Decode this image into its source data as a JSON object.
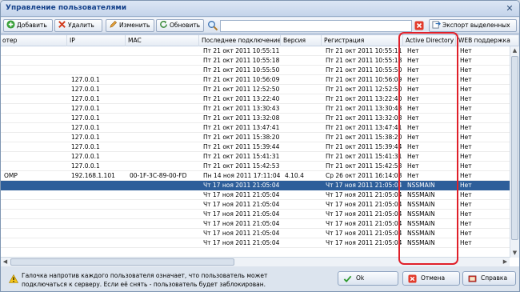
{
  "window": {
    "title": "Управление пользователями",
    "close_glyph": "✕"
  },
  "toolbar": {
    "add": "Добавить",
    "delete": "Удалить",
    "edit": "Изменить",
    "refresh": "Обновить",
    "search_value": "",
    "export": "Экспорт выделенных"
  },
  "columns": {
    "computer": "отер",
    "ip": "IP",
    "mac": "MAC",
    "last_conn": "Последнее подключение",
    "version": "Версия",
    "registration": "Регистрация",
    "ad": "Active Directory",
    "web": "WEB поддержка"
  },
  "rows": [
    {
      "computer": "",
      "ip": "",
      "mac": "",
      "last_conn": "Пт 21 окт 2011 10:55:11",
      "version": "",
      "registration": "Пт 21 окт 2011 10:55:11",
      "ad": "Нет",
      "web": "Нет",
      "selected": false
    },
    {
      "computer": "",
      "ip": "",
      "mac": "",
      "last_conn": "Пт 21 окт 2011 10:55:18",
      "version": "",
      "registration": "Пт 21 окт 2011 10:55:18",
      "ad": "Нет",
      "web": "Нет",
      "selected": false
    },
    {
      "computer": "",
      "ip": "",
      "mac": "",
      "last_conn": "Пт 21 окт 2011 10:55:50",
      "version": "",
      "registration": "Пт 21 окт 2011 10:55:50",
      "ad": "Нет",
      "web": "Нет",
      "selected": false
    },
    {
      "computer": "",
      "ip": "127.0.0.1",
      "mac": "",
      "last_conn": "Пт 21 окт 2011 10:56:09",
      "version": "",
      "registration": "Пт 21 окт 2011 10:56:09",
      "ad": "Нет",
      "web": "Нет",
      "selected": false
    },
    {
      "computer": "",
      "ip": "127.0.0.1",
      "mac": "",
      "last_conn": "Пт 21 окт 2011 12:52:50",
      "version": "",
      "registration": "Пт 21 окт 2011 12:52:50",
      "ad": "Нет",
      "web": "Нет",
      "selected": false
    },
    {
      "computer": "",
      "ip": "127.0.0.1",
      "mac": "",
      "last_conn": "Пт 21 окт 2011 13:22:40",
      "version": "",
      "registration": "Пт 21 окт 2011 13:22:40",
      "ad": "Нет",
      "web": "Нет",
      "selected": false
    },
    {
      "computer": "",
      "ip": "127.0.0.1",
      "mac": "",
      "last_conn": "Пт 21 окт 2011 13:30:43",
      "version": "",
      "registration": "Пт 21 окт 2011 13:30:43",
      "ad": "Нет",
      "web": "Нет",
      "selected": false
    },
    {
      "computer": "",
      "ip": "127.0.0.1",
      "mac": "",
      "last_conn": "Пт 21 окт 2011 13:32:08",
      "version": "",
      "registration": "Пт 21 окт 2011 13:32:08",
      "ad": "Нет",
      "web": "Нет",
      "selected": false
    },
    {
      "computer": "",
      "ip": "127.0.0.1",
      "mac": "",
      "last_conn": "Пт 21 окт 2011 13:47:41",
      "version": "",
      "registration": "Пт 21 окт 2011 13:47:41",
      "ad": "Нет",
      "web": "Нет",
      "selected": false
    },
    {
      "computer": "",
      "ip": "127.0.0.1",
      "mac": "",
      "last_conn": "Пт 21 окт 2011 15:38:20",
      "version": "",
      "registration": "Пт 21 окт 2011 15:38:20",
      "ad": "Нет",
      "web": "Нет",
      "selected": false
    },
    {
      "computer": "",
      "ip": "127.0.0.1",
      "mac": "",
      "last_conn": "Пт 21 окт 2011 15:39:44",
      "version": "",
      "registration": "Пт 21 окт 2011 15:39:44",
      "ad": "Нет",
      "web": "Нет",
      "selected": false
    },
    {
      "computer": "",
      "ip": "127.0.0.1",
      "mac": "",
      "last_conn": "Пт 21 окт 2011 15:41:31",
      "version": "",
      "registration": "Пт 21 окт 2011 15:41:31",
      "ad": "Нет",
      "web": "Нет",
      "selected": false
    },
    {
      "computer": "",
      "ip": "127.0.0.1",
      "mac": "",
      "last_conn": "Пт 21 окт 2011 15:42:53",
      "version": "",
      "registration": "Пт 21 окт 2011 15:42:53",
      "ad": "Нет",
      "web": "Нет",
      "selected": false
    },
    {
      "computer": "OMP",
      "ip": "192.168.1.101",
      "mac": "00-1F-3C-89-00-FD",
      "last_conn": "Пн 14 ноя 2011 17:11:04",
      "version": "4.10.4",
      "registration": "Ср 26 окт 2011 16:14:03",
      "ad": "Нет",
      "web": "Нет",
      "selected": false
    },
    {
      "computer": "",
      "ip": "",
      "mac": "",
      "last_conn": "Чт 17 ноя 2011 21:05:04",
      "version": "",
      "registration": "Чт 17 ноя 2011 21:05:04",
      "ad": "NSSMAIN",
      "web": "Нет",
      "selected": true
    },
    {
      "computer": "",
      "ip": "",
      "mac": "",
      "last_conn": "Чт 17 ноя 2011 21:05:04",
      "version": "",
      "registration": "Чт 17 ноя 2011 21:05:04",
      "ad": "NSSMAIN",
      "web": "Нет",
      "selected": false
    },
    {
      "computer": "",
      "ip": "",
      "mac": "",
      "last_conn": "Чт 17 ноя 2011 21:05:04",
      "version": "",
      "registration": "Чт 17 ноя 2011 21:05:04",
      "ad": "NSSMAIN",
      "web": "Нет",
      "selected": false
    },
    {
      "computer": "",
      "ip": "",
      "mac": "",
      "last_conn": "Чт 17 ноя 2011 21:05:04",
      "version": "",
      "registration": "Чт 17 ноя 2011 21:05:04",
      "ad": "NSSMAIN",
      "web": "Нет",
      "selected": false
    },
    {
      "computer": "",
      "ip": "",
      "mac": "",
      "last_conn": "Чт 17 ноя 2011 21:05:04",
      "version": "",
      "registration": "Чт 17 ноя 2011 21:05:04",
      "ad": "NSSMAIN",
      "web": "Нет",
      "selected": false
    },
    {
      "computer": "",
      "ip": "",
      "mac": "",
      "last_conn": "Чт 17 ноя 2011 21:05:04",
      "version": "",
      "registration": "Чт 17 ноя 2011 21:05:04",
      "ad": "NSSMAIN",
      "web": "Нет",
      "selected": false
    },
    {
      "computer": "",
      "ip": "",
      "mac": "",
      "last_conn": "Чт 17 ноя 2011 21:05:04",
      "version": "",
      "registration": "Чт 17 ноя 2011 21:05:04",
      "ad": "NSSMAIN",
      "web": "Нет",
      "selected": false
    }
  ],
  "footer": {
    "note_line1": "Галочка напротив каждого пользователя означает, что пользователь может",
    "note_line2": "подключаться к серверу. Если её снять - пользователь будет заблокирован.",
    "ok": "Ok",
    "cancel": "Отмена",
    "help": "Справка"
  },
  "colors": {
    "selected_row": "#2e5e9a",
    "highlight_box": "#e0202a",
    "title_text": "#15428b"
  }
}
